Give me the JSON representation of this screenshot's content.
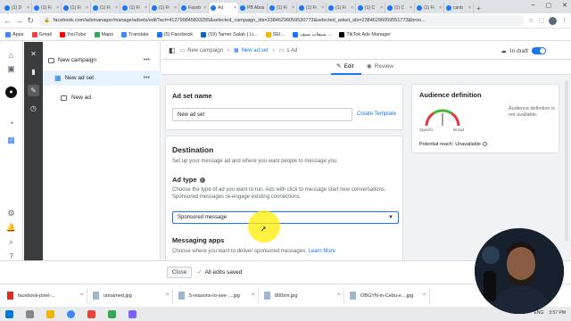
{
  "browser": {
    "tabs": [
      {
        "label": "(1) D"
      },
      {
        "label": "(1) Fi"
      },
      {
        "label": "(1) Fi"
      },
      {
        "label": "(1) Fi"
      },
      {
        "label": "(1) Fi"
      },
      {
        "label": "(1) Fi"
      },
      {
        "label": "Faceb"
      },
      {
        "label": "Ad"
      },
      {
        "label": "PB Abou"
      },
      {
        "label": "(1) Fi"
      },
      {
        "label": "(1) Fi"
      },
      {
        "label": "(1) Fi"
      },
      {
        "label": "(1) C"
      },
      {
        "label": "(1) C"
      },
      {
        "label": "(1) Fi"
      },
      {
        "label": "canb"
      }
    ],
    "new_tab": "+",
    "url": "facebook.com/adsmanager/manage/adsets/edit?act=412799845833255&selected_campaign_ids=23846296059530773&selected_adset_ids=23846296059551773&broo...",
    "bookmarks": [
      {
        "label": "Apps",
        "color": "#4285f4"
      },
      {
        "label": "Gmail",
        "color": "#ea4335"
      },
      {
        "label": "YouTube",
        "color": "#ff0000"
      },
      {
        "label": "Maps",
        "color": "#34a853"
      },
      {
        "label": "Translate",
        "color": "#4285f4"
      },
      {
        "label": "(5) Facebook",
        "color": "#1877f2"
      },
      {
        "label": "(19) Tamer Salah | Li...",
        "color": "#0a66c2"
      },
      {
        "label": "SEI...",
        "color": "#f4b400"
      },
      {
        "label": "مبيعات سيف ...",
        "color": "#1877f2"
      },
      {
        "label": "TikTok Ads Manager",
        "color": "#000000"
      }
    ]
  },
  "tree": {
    "campaign": "New campaign",
    "adset": "New ad set",
    "ad": "New ad",
    "more": "•••"
  },
  "header": {
    "crumbs": [
      "New campaign",
      "New ad set",
      "1 Ad"
    ],
    "status": "In draft"
  },
  "subtabs": {
    "edit": "Edit",
    "review": "Review"
  },
  "adset_name": {
    "title": "Ad set name",
    "value": "New ad set",
    "template_link": "Create Template"
  },
  "destination": {
    "title": "Destination",
    "subtitle": "Set up your message ad and where you want people to message you.",
    "ad_type_label": "Ad type",
    "ad_type_help": "Choose the type of ad you want to run. Ads with click to message start new conversations. Sponsored messages re-engage existing connections.",
    "ad_type_value": "Sponsored message",
    "messaging_apps_title": "Messaging apps",
    "messaging_apps_help": "Choose where you want to deliver sponsored messages.",
    "learn_more": "Learn More"
  },
  "audience": {
    "title": "Audience definition",
    "gauge_left": "Specific",
    "gauge_right": "Broad",
    "note": "Audience definition is not available.",
    "reach_label": "Potential reach:",
    "reach_value": "Unavailable"
  },
  "footer": {
    "close": "Close",
    "saved": "All edits saved"
  },
  "downloads": [
    {
      "name": "facebook-pixel-...",
      "type": "pdf"
    },
    {
      "name": "unnamed.jpg",
      "type": "img"
    },
    {
      "name": "5-reasons-to-see-....jpg",
      "type": "img"
    },
    {
      "name": "800xm.jpg",
      "type": "img"
    },
    {
      "name": "OBGYN-in-Cebu-e....jpg",
      "type": "img"
    }
  ],
  "taskbar": {
    "lang": "ENG",
    "time": "3:57 PM"
  },
  "colors": {
    "accent": "#1877f2",
    "dark_rail": "#3a3b3c",
    "background": "#f0f2f5",
    "highlight": "#ffee00"
  }
}
